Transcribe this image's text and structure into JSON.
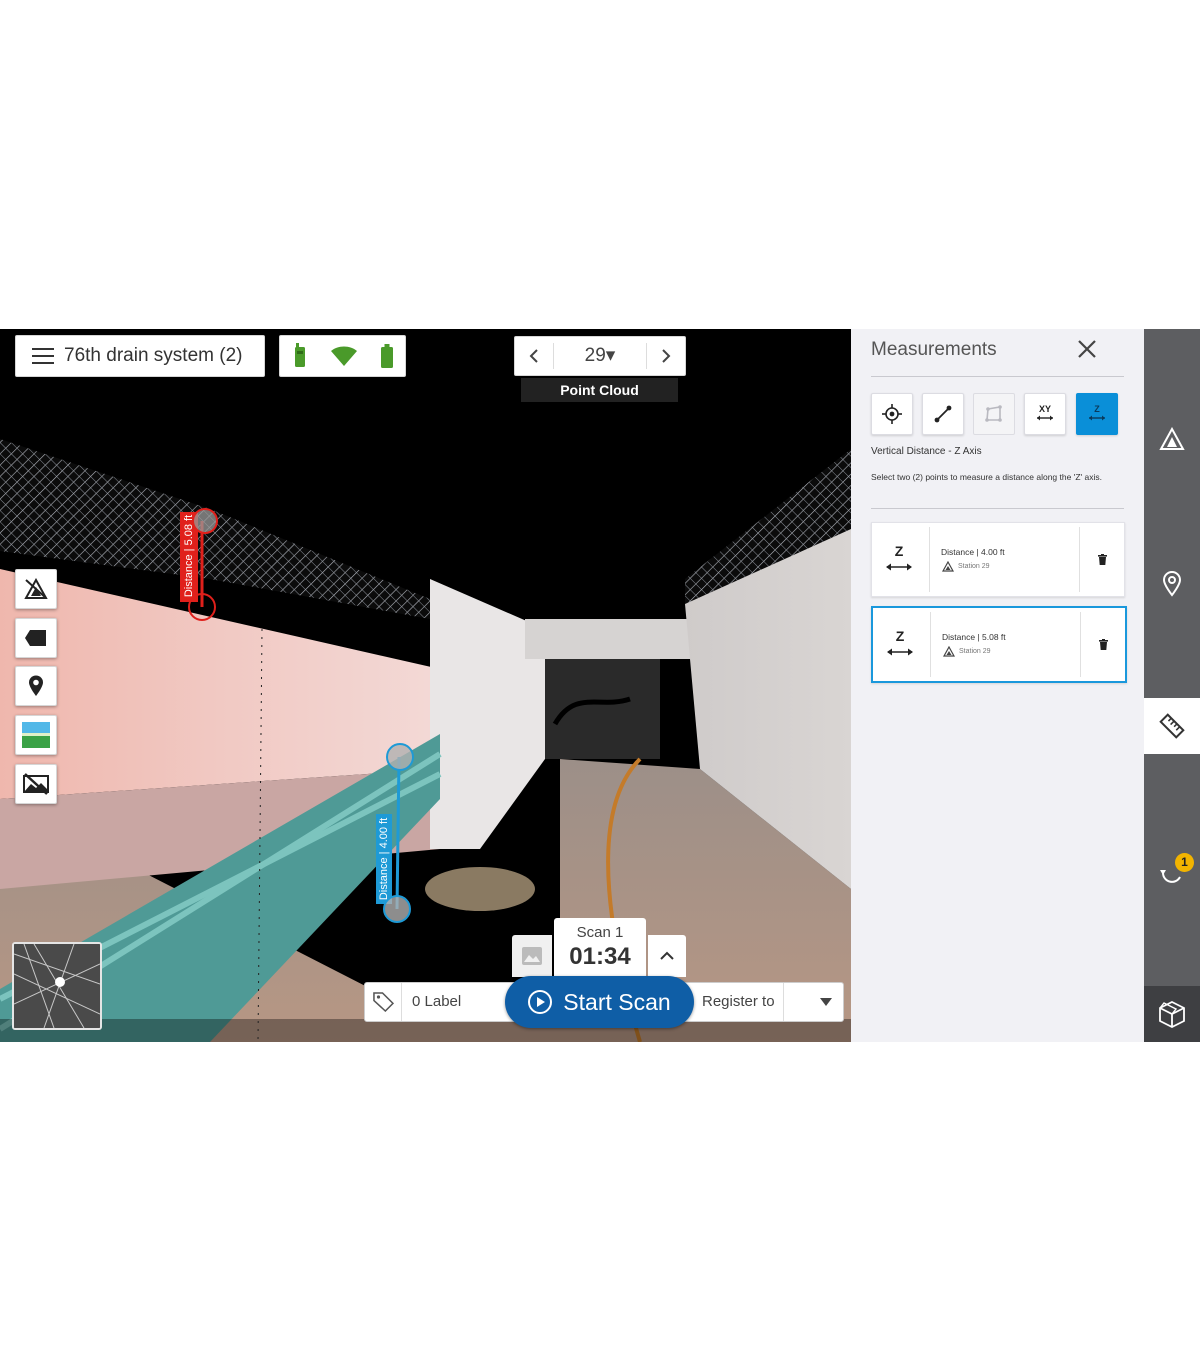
{
  "header": {
    "project_title": "76th drain system (2)",
    "station_number": "29▾",
    "view_mode": "Point Cloud"
  },
  "status_icons": [
    "scanner-icon",
    "wifi-icon",
    "battery-icon"
  ],
  "left_tools": [
    "scan-measure-icon",
    "label-tag-icon",
    "location-pin-icon",
    "image-view-icon",
    "hide-image-icon"
  ],
  "scene_measurements": [
    {
      "label": "Distance | 5.08 ft",
      "color": "#e0201b"
    },
    {
      "label": "Distance | 4.00 ft",
      "color": "#1e9ad6"
    }
  ],
  "scan": {
    "name": "Scan 1",
    "timer": "01:34",
    "start_label": "Start Scan",
    "label_count": "0 Label",
    "register_label": "Register to"
  },
  "measurements_panel": {
    "title": "Measurements",
    "tools": [
      "target-point-icon",
      "line-distance-icon",
      "area-icon",
      "xy-distance-icon",
      "z-distance-icon"
    ],
    "active_tool": "z-distance-icon",
    "mode_title": "Vertical Distance - Z Axis",
    "mode_desc": "Select two (2) points to measure a distance along the 'Z' axis.",
    "items": [
      {
        "label": "Distance | 4.00 ft",
        "station": "Station 29",
        "selected": false
      },
      {
        "label": "Distance | 5.08 ft",
        "station": "Station 29",
        "selected": true
      }
    ]
  },
  "right_rail": {
    "items": [
      "stations-icon",
      "location-pin-icon",
      "ruler-icon",
      "sync-icon",
      "cube-icon"
    ],
    "badge": "1"
  },
  "colors": {
    "accent": "#0a8fd8",
    "start_scan": "#0f5ea6",
    "rail": "#5d5e61",
    "status_green": "#4a9a2a"
  }
}
